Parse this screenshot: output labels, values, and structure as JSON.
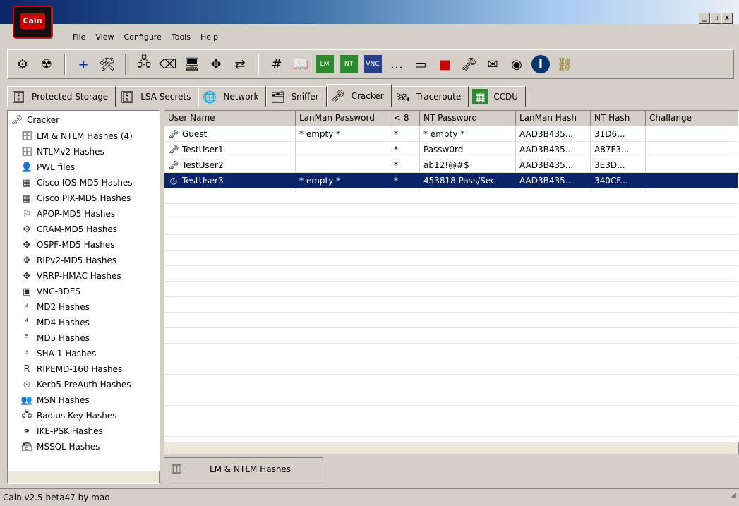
{
  "app": {
    "logo_text": "Cain",
    "controls": [
      "_",
      "□",
      "x"
    ]
  },
  "menu": {
    "items": [
      "File",
      "View",
      "Configure",
      "Tools",
      "Help"
    ]
  },
  "toolbar": {
    "icons": [
      "options-icon",
      "radiation-icon",
      "add-icon",
      "tool-icon",
      "network-icon",
      "clear-icon",
      "monitor-icon",
      "move-icon",
      "transfer-icon",
      "hash-icon",
      "dictionary-icon",
      "lm-icon",
      "nt-icon",
      "vnc-icon",
      "password-icon",
      "database-icon",
      "stop-icon",
      "decoder-icon",
      "certificate-icon",
      "audio-icon",
      "info-icon",
      "help-icon"
    ]
  },
  "tabs": [
    {
      "label": "Protected Storage",
      "icon": "protected-storage-icon"
    },
    {
      "label": "LSA Secrets",
      "icon": "lsa-icon"
    },
    {
      "label": "Network",
      "icon": "network-icon"
    },
    {
      "label": "Sniffer",
      "icon": "sniffer-icon"
    },
    {
      "label": "Cracker",
      "icon": "cracker-icon"
    },
    {
      "label": "Traceroute",
      "icon": "traceroute-icon"
    },
    {
      "label": "CCDU",
      "icon": "ccdu-icon"
    }
  ],
  "tree": {
    "root": "Cracker",
    "items": [
      "LM & NTLM Hashes (4)",
      "NTLMv2 Hashes",
      "PWL files",
      "Cisco IOS-MD5 Hashes",
      "Cisco PIX-MD5 Hashes",
      "APOP-MD5 Hashes",
      "CRAM-MD5 Hashes",
      "OSPF-MD5 Hashes",
      "RIPv2-MD5 Hashes",
      "VRRP-HMAC Hashes",
      "VNC-3DES",
      "MD2 Hashes",
      "MD4 Hashes",
      "MD5 Hashes",
      "SHA-1 Hashes",
      "RIPEMD-160 Hashes",
      "Kerb5 PreAuth Hashes",
      "MSN Hashes",
      "Radius Key Hashes",
      "IKE-PSK Hashes",
      "MSSQL Hashes"
    ]
  },
  "table": {
    "columns": [
      "User Name",
      "LanMan Password",
      "< 8",
      "NT Password",
      "LanMan Hash",
      "NT Hash",
      "Challange"
    ],
    "rows": [
      {
        "user": "Guest",
        "lm_password": "* empty *",
        "lt8": "*",
        "nt_password": "* empty *",
        "lm_hash": "AAD3B435...",
        "nt_hash": "31D6...",
        "challenge": ""
      },
      {
        "user": "TestUser1",
        "lm_password": "",
        "lt8": "*",
        "nt_password": "Passw0rd",
        "lm_hash": "AAD3B435...",
        "nt_hash": "A87F3...",
        "challenge": ""
      },
      {
        "user": "TestUser2",
        "lm_password": "",
        "lt8": "*",
        "nt_password": "ab12!@#$",
        "lm_hash": "AAD3B435...",
        "nt_hash": "3E3D...",
        "challenge": ""
      },
      {
        "user": "TestUser3",
        "lm_password": "* empty *",
        "lt8": "*",
        "nt_password": "453818 Pass/Sec",
        "lm_hash": "AAD3B435...",
        "nt_hash": "340CF...",
        "challenge": ""
      }
    ]
  },
  "bottom_tab": {
    "label": "LM & NTLM Hashes"
  },
  "status": {
    "text": "Cain v2.5 beta47 by mao"
  }
}
